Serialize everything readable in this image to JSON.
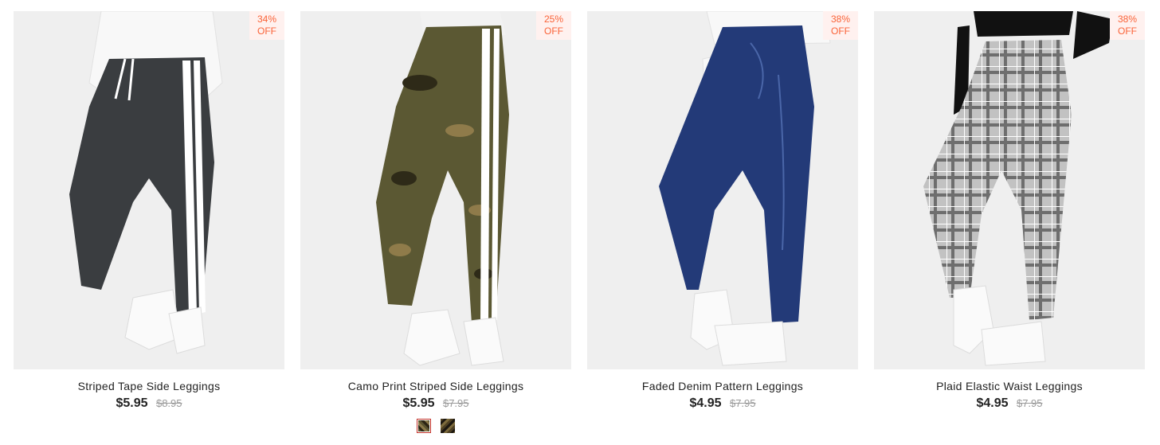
{
  "products": [
    {
      "title": "Striped Tape Side Leggings",
      "discount_pct": "34%",
      "discount_off": "OFF",
      "price": "$5.95",
      "original_price": "$8.95",
      "color": "#3a3d40"
    },
    {
      "title": "Camo Print Striped Side Leggings",
      "discount_pct": "25%",
      "discount_off": "OFF",
      "price": "$5.95",
      "original_price": "$7.95",
      "color": "#5b5833",
      "swatches": [
        "camo-green",
        "camo-brown"
      ],
      "selected_swatch": "camo-green"
    },
    {
      "title": "Faded Denim Pattern Leggings",
      "discount_pct": "38%",
      "discount_off": "OFF",
      "price": "$4.95",
      "original_price": "$7.95",
      "color": "#233a78"
    },
    {
      "title": "Plaid Elastic Waist Leggings",
      "discount_pct": "38%",
      "discount_off": "OFF",
      "price": "$4.95",
      "original_price": "$7.95",
      "color": "#b9b9b9"
    }
  ],
  "colors": {
    "badge_bg": "#fff1ef",
    "badge_text": "#fa6338",
    "swatch_selected_border": "#c4322a"
  }
}
